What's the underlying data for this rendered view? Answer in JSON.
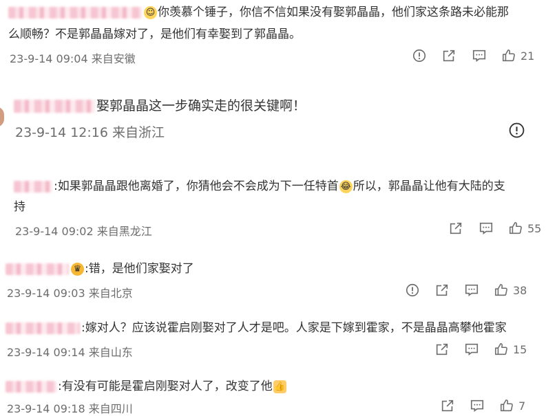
{
  "comments": [
    {
      "text_line1": "你羡慕个锤子，你信不信如果没有娶郭晶晶，他们家这条路未必能那",
      "text_line2": "么顺畅？不是郭晶晶嫁对了，是他们有幸娶到了郭晶晶。",
      "emoji": "drooling-emoji",
      "time": "23-9-14 09:04",
      "location": "来自安徽",
      "like_count": "21",
      "actions": [
        "report",
        "share",
        "comment",
        "like"
      ]
    },
    {
      "text_line1": "娶郭晶晶这一步确实走的很关键啊！",
      "time": "23-9-14 12:16",
      "location": "来自浙江",
      "actions": [
        "report"
      ]
    },
    {
      "text_line1": ":如果郭晶晶跟他离婚了，你猜他会不会成为下一任特首",
      "text_line1b": "所以，郭晶晶让他有大陆的支",
      "text_line2": "持",
      "emoji": "laughing-tears-emoji",
      "time": "23-9-14 09:02",
      "location": "来自黑龙江",
      "like_count": "55",
      "actions": [
        "share",
        "comment",
        "like"
      ]
    },
    {
      "text_line1": ":错，是他们家娶对了",
      "emoji": "crown-emoji",
      "time": "23-9-14 09:03",
      "location": "来自北京",
      "like_count": "38",
      "actions": [
        "report",
        "share",
        "comment",
        "like"
      ]
    },
    {
      "text_line1": ":嫁对人？应该说霍启刚娶对了人才是吧。人家是下嫁到霍家，不是晶晶高攀他霍家",
      "time": "23-9-14 09:14",
      "location": "来自山东",
      "like_count": "15",
      "actions": [
        "share",
        "comment",
        "like"
      ]
    },
    {
      "text_line1": ":有没有可能是霍启刚娶对人了，改变了他",
      "emoji": "thumbs-up-emoji",
      "time": "23-9-14 09:18",
      "location": "来自四川",
      "like_count": "7",
      "actions": [
        "share",
        "comment",
        "like"
      ]
    }
  ],
  "colors": {
    "text": "#333333",
    "meta": "#6d6d6d",
    "blur_pink": "#f6c2cf"
  }
}
